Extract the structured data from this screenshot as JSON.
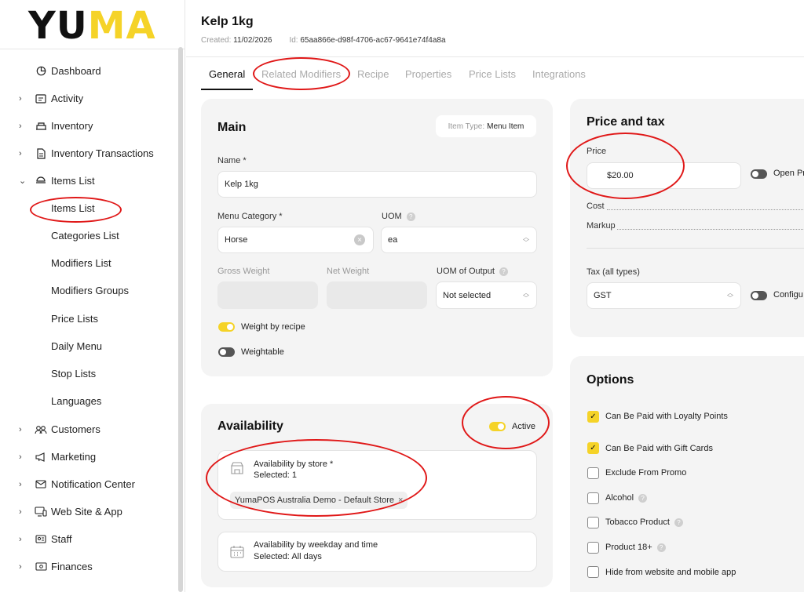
{
  "logo": {
    "part1": "YU",
    "part2": "MA"
  },
  "sidebar": {
    "dashboard": "Dashboard",
    "activity": "Activity",
    "inventory": "Inventory",
    "inventory_transactions": "Inventory Transactions",
    "items_list": "Items List",
    "sub": {
      "items_list": "Items List",
      "categories_list": "Categories List",
      "modifiers_list": "Modifiers List",
      "modifiers_groups": "Modifiers Groups",
      "price_lists": "Price Lists",
      "daily_menu": "Daily Menu",
      "stop_lists": "Stop Lists",
      "languages": "Languages"
    },
    "customers": "Customers",
    "marketing": "Marketing",
    "notification_center": "Notification Center",
    "web_site_app": "Web Site & App",
    "staff": "Staff",
    "finances": "Finances"
  },
  "header": {
    "title": "Kelp 1kg",
    "created_label": "Created:",
    "created_value": "11/02/2026",
    "id_label": "Id:",
    "id_value": "65aa866e-d98f-4706-ac67-9641e74f4a8a"
  },
  "tabs": {
    "general": "General",
    "related_modifiers": "Related Modifiers",
    "recipe": "Recipe",
    "properties": "Properties",
    "price_lists": "Price Lists",
    "integrations": "Integrations"
  },
  "main": {
    "title": "Main",
    "item_type_label": "Item Type:",
    "item_type_value": "Menu Item",
    "name_label": "Name *",
    "name_value": "Kelp 1kg",
    "menu_category_label": "Menu Category *",
    "menu_category_value": "Horse",
    "uom_label": "UOM",
    "uom_value": "ea",
    "gross_weight_label": "Gross Weight",
    "net_weight_label": "Net Weight",
    "uom_output_label": "UOM of Output",
    "uom_output_value": "Not selected",
    "weight_by_recipe": "Weight by recipe",
    "weightable": "Weightable"
  },
  "availability": {
    "title": "Availability",
    "active_label": "Active",
    "by_store_label": "Availability by store *",
    "by_store_selected": "Selected: 1",
    "store_chip": "YumaPOS Australia Demo - Default Store",
    "chip_remove": "×",
    "by_weekday_label": "Availability by weekday and time",
    "by_weekday_selected": "Selected: All days"
  },
  "price_tax": {
    "title": "Price and tax",
    "price_label": "Price",
    "price_value": "$20.00",
    "open_price_label": "Open Pr",
    "cost_label": "Cost",
    "markup_label": "Markup",
    "tax_label": "Tax (all types)",
    "tax_value": "GST",
    "configure_label": "Configu"
  },
  "options": {
    "title": "Options",
    "items": [
      {
        "label": "Can Be Paid with Loyalty Points",
        "checked": true,
        "help": false
      },
      {
        "label": "Can Be Paid with Gift Cards",
        "checked": true,
        "help": false
      },
      {
        "label": "Exclude From Promo",
        "checked": false,
        "help": false
      },
      {
        "label": "Alcohol",
        "checked": false,
        "help": true
      },
      {
        "label": "Tobacco Product",
        "checked": false,
        "help": true
      },
      {
        "label": "Product 18+",
        "checked": false,
        "help": true
      },
      {
        "label": "Hide from website and mobile app",
        "checked": false,
        "help": false
      }
    ]
  },
  "colors": {
    "accent": "#f5d328",
    "annotation": "#e01818",
    "card_bg": "#f4f4f4"
  }
}
